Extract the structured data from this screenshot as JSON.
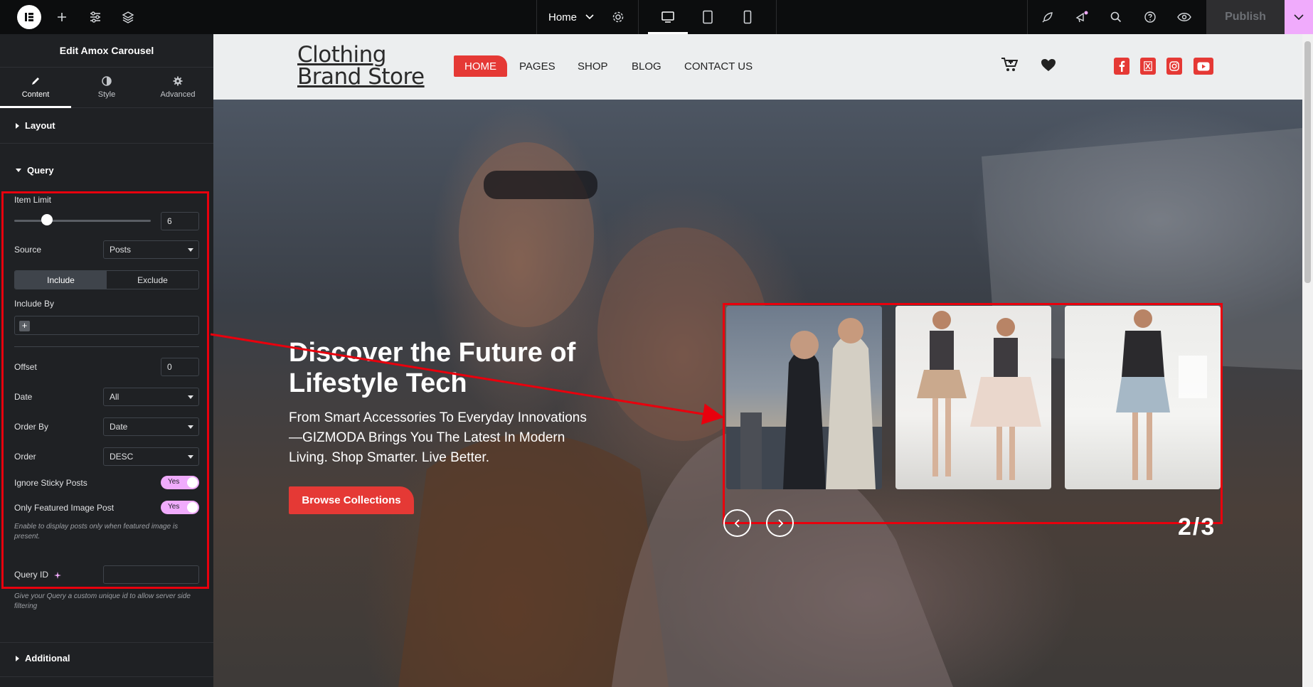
{
  "topbar": {
    "page_label": "Home",
    "publish_label": "Publish"
  },
  "panel": {
    "title": "Edit Amox Carousel",
    "tabs": [
      {
        "label": "Content",
        "icon": "pencil-icon"
      },
      {
        "label": "Style",
        "icon": "half-circle-icon"
      },
      {
        "label": "Advanced",
        "icon": "gear-icon"
      }
    ],
    "sections": {
      "layout": "Layout",
      "query": "Query",
      "additional": "Additional"
    },
    "query": {
      "item_limit_label": "Item Limit",
      "item_limit_value": "6",
      "item_limit_slider_fraction": 0.24,
      "source_label": "Source",
      "source_value": "Posts",
      "include_label": "Include",
      "exclude_label": "Exclude",
      "include_by_label": "Include By",
      "add_symbol": "+",
      "offset_label": "Offset",
      "offset_value": "0",
      "date_label": "Date",
      "date_value": "All",
      "order_by_label": "Order By",
      "order_by_value": "Date",
      "order_label": "Order",
      "order_value": "DESC",
      "ignore_sticky_label": "Ignore Sticky Posts",
      "ignore_sticky_value": "Yes",
      "featured_label": "Only Featured Image Post",
      "featured_value": "Yes",
      "featured_hint": "Enable to display posts only when featured image is present.",
      "query_id_label": "Query ID",
      "query_id_value": "",
      "query_id_hint": "Give your Query a custom unique id to allow server side filtering"
    }
  },
  "site": {
    "brand_line1": "Clothing",
    "brand_line2": "Brand Store",
    "nav": [
      "HOME",
      "PAGES",
      "SHOP",
      "BLOG",
      "CONTACT US"
    ],
    "social_icons": [
      "facebook-icon",
      "x-icon",
      "instagram-icon",
      "youtube-icon"
    ],
    "hero": {
      "title": "Discover the Future of Lifestyle Tech",
      "subtitle": "From Smart Accessories To Everyday Innovations —GIZMODA Brings You The Latest In Modern Living. Shop Smarter. Live Better.",
      "button": "Browse Collections"
    },
    "carousel": {
      "counter": "2/3"
    }
  },
  "colors": {
    "accent": "#e53935",
    "highlight_box": "#e8000d",
    "toggle": "#f0abfc",
    "panel_bg": "#1f2124"
  }
}
